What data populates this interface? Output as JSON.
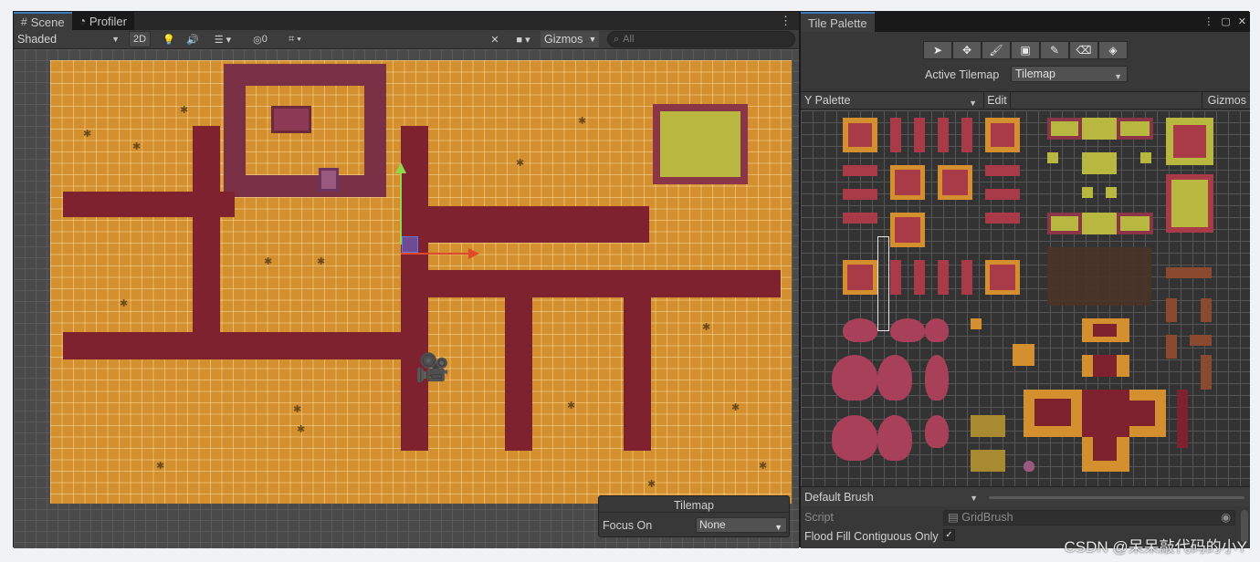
{
  "scene": {
    "tabs": [
      {
        "label": "Scene",
        "icon": "grid-icon"
      },
      {
        "label": "Profiler",
        "icon": "profiler-icon"
      }
    ],
    "toolbar": {
      "shading_mode": "Shaded",
      "mode_2d": "2D",
      "hidden_count": "0",
      "gizmos": "Gizmos",
      "search_placeholder": "All"
    },
    "overlay": {
      "title": "Tilemap",
      "focus_label": "Focus On",
      "focus_value": "None"
    }
  },
  "palette": {
    "tab_label": "Tile Palette",
    "tools": [
      "select-tool-icon",
      "move-tool-icon",
      "paint-tool-icon",
      "box-fill-tool-icon",
      "picker-tool-icon",
      "eraser-tool-icon",
      "fill-tool-icon"
    ],
    "active_tilemap_label": "Active Tilemap",
    "active_tilemap_value": "Tilemap",
    "palette_name": "Y Palette",
    "edit_label": "Edit",
    "gizmos_label": "Gizmos",
    "brush_name": "Default Brush",
    "script_label": "Script",
    "script_value": "GridBrush",
    "flood_fill_label": "Flood Fill Contiguous Only",
    "flood_fill_checked": true
  },
  "watermark": "CSDN @呆呆敲代码的小Y",
  "colors": {
    "ground": "#d4902e",
    "path": "#7e2230",
    "hedge": "#7a3145",
    "accent": "#3a79bb",
    "gizmo_x": "#e04a2a",
    "gizmo_y": "#8ed64a"
  }
}
